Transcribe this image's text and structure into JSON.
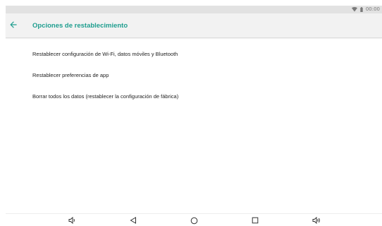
{
  "status_bar": {
    "time": "00:00",
    "icons": [
      "wifi-icon",
      "battery-icon"
    ]
  },
  "app_bar": {
    "back_icon": "arrow-left-icon",
    "title": "Opciones de restablecimiento",
    "accent_color": "#1f9e8f"
  },
  "options": [
    {
      "label": "Restablecer configuración de Wi-Fi, datos móviles y Bluetooth"
    },
    {
      "label": "Restablecer preferencias de app"
    },
    {
      "label": "Borrar todos los datos (restablecer la configuración de fábrica)"
    }
  ],
  "nav_bar": {
    "buttons": [
      "volume-down-icon",
      "back-triangle-icon",
      "home-circle-icon",
      "recents-square-icon",
      "volume-up-icon"
    ]
  }
}
